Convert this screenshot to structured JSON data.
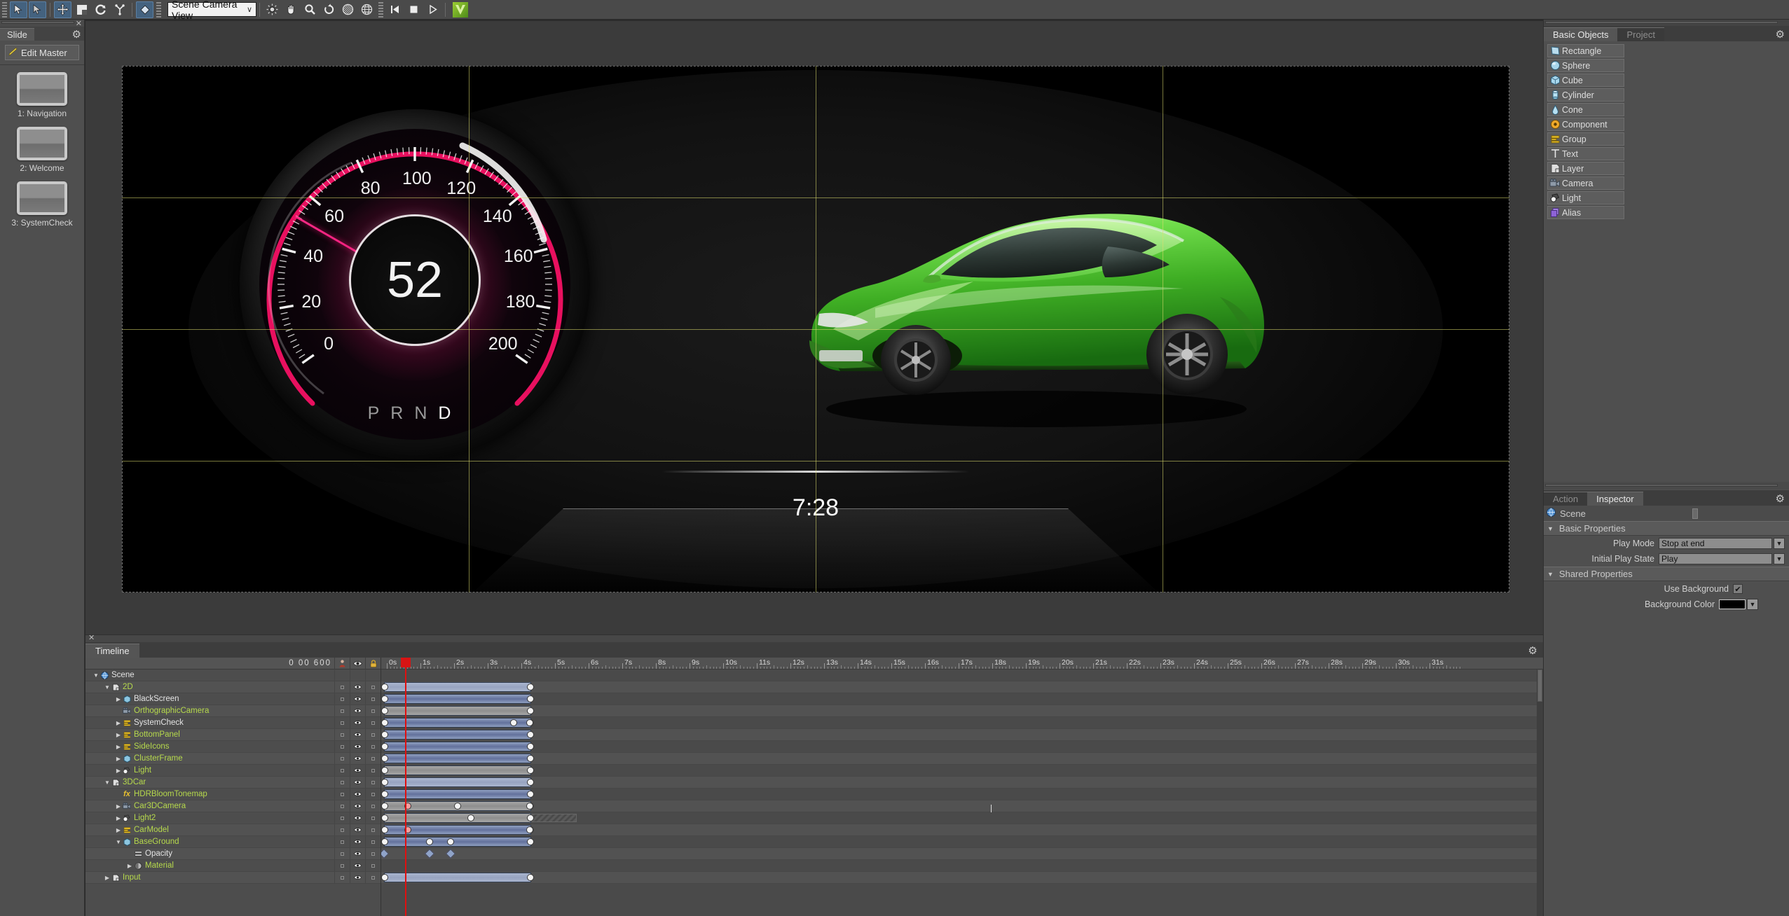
{
  "toolbar": {
    "tools": [
      {
        "name": "select-arrow-tool",
        "glyph": "➤",
        "selected": true
      },
      {
        "name": "group-select-tool",
        "glyph": "➤",
        "selected": true
      },
      {
        "name": "move-tool",
        "glyph": "✥",
        "selected": true
      },
      {
        "name": "scale-tool",
        "glyph": "◰",
        "selected": false
      },
      {
        "name": "rotate-tool",
        "glyph": "↻",
        "selected": false
      },
      {
        "name": "global-local-tool",
        "glyph": "⤴",
        "selected": false
      },
      {
        "name": "keyframe-tool",
        "glyph": "◆",
        "selected": true
      }
    ],
    "camera_select": {
      "value": "Scene Camera View",
      "arrow": "∨"
    },
    "view_tools": [
      {
        "name": "orbit-icon",
        "glyph": "✹"
      },
      {
        "name": "pan-hand-icon",
        "glyph": "✋"
      },
      {
        "name": "zoom-magnifier-icon",
        "glyph": "⚲"
      },
      {
        "name": "reset-view-icon",
        "glyph": "↻"
      },
      {
        "name": "shading-mode-icon",
        "glyph": "▒"
      },
      {
        "name": "wireframe-globe-icon",
        "glyph": "⊕"
      }
    ],
    "playback": [
      {
        "name": "rewind-to-start-button",
        "glyph": "⏮"
      },
      {
        "name": "stop-button",
        "glyph": "■"
      },
      {
        "name": "play-button",
        "glyph": "▶"
      }
    ],
    "app_logo": "V"
  },
  "slide_panel": {
    "tab_label": "Slide",
    "edit_master_label": "Edit Master",
    "gear_icon": "⚙",
    "close_icon": "✕",
    "slides": [
      {
        "label": "1: Navigation"
      },
      {
        "label": "2: Welcome"
      },
      {
        "label": "3: SystemCheck"
      }
    ]
  },
  "viewport": {
    "gauge": {
      "speed_value": "52",
      "ticks": [
        "0",
        "20",
        "40",
        "60",
        "80",
        "100",
        "120",
        "140",
        "160",
        "180",
        "200"
      ],
      "gear_letters": [
        "P",
        "R",
        "N",
        "D"
      ],
      "active_gear": "D",
      "needle_value": 52,
      "min": 0,
      "max": 200,
      "accent_color": "#f0147a"
    },
    "clock": "7:28",
    "car_color": "#5ed13a"
  },
  "right_panel": {
    "tabs": [
      {
        "label": "Basic Objects",
        "active": true
      },
      {
        "label": "Project",
        "active": false
      }
    ],
    "gear_icon": "⚙",
    "basic_objects": [
      {
        "label": "Rectangle",
        "icon": "rectangle-icon",
        "glyph": "◱",
        "color": "#9fd0e8"
      },
      {
        "label": "Sphere",
        "icon": "sphere-icon",
        "glyph": "●",
        "color": "#a8d8ee"
      },
      {
        "label": "Cube",
        "icon": "cube-icon",
        "glyph": "⬟",
        "color": "#a8d8ee"
      },
      {
        "label": "Cylinder",
        "icon": "cylinder-icon",
        "glyph": "▮",
        "color": "#b5e0f2"
      },
      {
        "label": "Cone",
        "icon": "cone-icon",
        "glyph": "▲",
        "color": "#b5e0f2"
      },
      {
        "label": "Component",
        "icon": "component-icon",
        "glyph": "◉",
        "color": "#f0a92a"
      },
      {
        "label": "Group",
        "icon": "group-icon",
        "glyph": "☰",
        "color": "#f2c020"
      },
      {
        "label": "Text",
        "icon": "text-icon",
        "glyph": "T",
        "color": "#e8e8e8"
      },
      {
        "label": "Layer",
        "icon": "layer-icon",
        "glyph": "◳",
        "color": "#dddddd"
      },
      {
        "label": "Camera",
        "icon": "camera-icon",
        "glyph": "὏7",
        "color": "#9aa6b5"
      },
      {
        "label": "Light",
        "icon": "light-icon",
        "glyph": "◑",
        "color": "#f0f0f0"
      },
      {
        "label": "Alias",
        "icon": "alias-icon",
        "glyph": "❐",
        "color": "#9b6ede"
      }
    ]
  },
  "inspector": {
    "tabs": [
      {
        "label": "Action",
        "active": false
      },
      {
        "label": "Inspector",
        "active": true
      }
    ],
    "gear_icon": "⚙",
    "object_name": "Scene",
    "object_icon": "globe-icon",
    "sections": [
      {
        "title": "Basic Properties",
        "rows": [
          {
            "label": "Play Mode",
            "type": "select",
            "value": "Stop at end"
          },
          {
            "label": "Initial Play State",
            "type": "select",
            "value": "Play"
          }
        ]
      },
      {
        "title": "Shared Properties",
        "rows": [
          {
            "label": "Use Background",
            "type": "checkbox",
            "value": "✔"
          },
          {
            "label": "Background Color",
            "type": "color",
            "value": "#000000"
          }
        ]
      }
    ]
  },
  "timeline": {
    "tab_label": "Timeline",
    "gear_icon": "⚙",
    "close_icon": "✕",
    "time_readout": "0  00  600",
    "column_icons": [
      {
        "name": "shy-column-icon",
        "glyph": "♟"
      },
      {
        "name": "visible-eye-column-icon",
        "glyph": "◉"
      },
      {
        "name": "lock-column-icon",
        "glyph": "ὑ2"
      }
    ],
    "ruler_labels": [
      "0s",
      "1s",
      "2s",
      "3s",
      "4s",
      "5s",
      "6s",
      "7s",
      "8s",
      "9s",
      "10s",
      "11s",
      "12s",
      "13s",
      "14s",
      "15s",
      "16s",
      "17s",
      "18s",
      "19s",
      "20s",
      "21s",
      "22s",
      "23s",
      "24s",
      "25s",
      "26s",
      "27s",
      "28s",
      "29s",
      "30s",
      "31s"
    ],
    "playhead_time": "0s",
    "rows": [
      {
        "name": "Scene",
        "indent": 0,
        "tri": "down",
        "icon": "globe-icon",
        "glyph": "◉",
        "color": "white",
        "bar": null,
        "header": true
      },
      {
        "name": "2D",
        "indent": 1,
        "tri": "down",
        "icon": "layer-icon",
        "glyph": "◳",
        "color": "green",
        "bar": {
          "type": "lblue",
          "start": 0,
          "end": 100
        },
        "keys": []
      },
      {
        "name": "BlackScreen",
        "indent": 2,
        "tri": "right",
        "icon": "cube-icon",
        "glyph": "⬟",
        "color": "white",
        "bar": {
          "type": "blue",
          "start": 0,
          "end": 100
        },
        "keys": []
      },
      {
        "name": "OrthographicCamera",
        "indent": 2,
        "tri": "none",
        "icon": "camera-icon",
        "glyph": "὏7",
        "color": "green",
        "bar": {
          "type": "grey",
          "start": 0,
          "end": 100
        },
        "keys": []
      },
      {
        "name": "SystemCheck",
        "indent": 2,
        "tri": "right",
        "icon": "group-icon",
        "glyph": "☰",
        "color": "white",
        "bar": {
          "type": "blue",
          "start": 0,
          "end": 100
        },
        "keys": [
          {
            "pos": 88,
            "red": false
          },
          {
            "pos": 99,
            "red": false
          }
        ]
      },
      {
        "name": "BottomPanel",
        "indent": 2,
        "tri": "right",
        "icon": "group-icon",
        "glyph": "☰",
        "color": "green",
        "bar": {
          "type": "blue",
          "start": 0,
          "end": 100
        },
        "keys": []
      },
      {
        "name": "SideIcons",
        "indent": 2,
        "tri": "right",
        "icon": "group-icon",
        "glyph": "☰",
        "color": "green",
        "bar": {
          "type": "blue",
          "start": 0,
          "end": 100
        },
        "keys": []
      },
      {
        "name": "ClusterFrame",
        "indent": 2,
        "tri": "right",
        "icon": "cube-icon",
        "glyph": "⬟",
        "color": "green",
        "bar": {
          "type": "blue",
          "start": 0,
          "end": 100
        },
        "keys": []
      },
      {
        "name": "Light",
        "indent": 2,
        "tri": "right",
        "icon": "light-icon",
        "glyph": "◑",
        "color": "green",
        "bar": {
          "type": "grey",
          "start": 0,
          "end": 100
        },
        "keys": []
      },
      {
        "name": "3DCar",
        "indent": 1,
        "tri": "down",
        "icon": "layer-icon",
        "glyph": "◳",
        "color": "green",
        "bar": {
          "type": "lblue",
          "start": 0,
          "end": 100
        },
        "keys": []
      },
      {
        "name": "HDRBloomTonemap",
        "indent": 2,
        "tri": "none",
        "icon": "effect-fx-icon",
        "glyph": "fx",
        "color": "green",
        "bar": {
          "type": "blue",
          "start": 0,
          "end": 100
        },
        "keys": []
      },
      {
        "name": "Car3DCamera",
        "indent": 2,
        "tri": "right",
        "icon": "camera-icon",
        "glyph": "὏7",
        "color": "green",
        "bar": {
          "type": "grey",
          "start": 0,
          "end": 100
        },
        "keys": [
          {
            "pos": 16,
            "red": true
          },
          {
            "pos": 50,
            "red": false
          },
          {
            "pos": 99,
            "red": false
          }
        ]
      },
      {
        "name": "Light2",
        "indent": 2,
        "tri": "right",
        "icon": "light-icon",
        "glyph": "◑",
        "color": "green",
        "bar": {
          "type": "grey",
          "start": 0,
          "end": 100
        },
        "keys": [
          {
            "pos": 59,
            "red": false
          }
        ],
        "hatch": {
          "start": 102,
          "end": 133
        }
      },
      {
        "name": "CarModel",
        "indent": 2,
        "tri": "right",
        "icon": "group-icon",
        "glyph": "☰",
        "color": "green",
        "bar": {
          "type": "blue",
          "start": 0,
          "end": 100
        },
        "keys": [
          {
            "pos": 16,
            "red": true
          },
          {
            "pos": 99,
            "red": false
          }
        ]
      },
      {
        "name": "BaseGround",
        "indent": 2,
        "tri": "down",
        "icon": "cube-icon",
        "glyph": "⬟",
        "color": "green",
        "bar": {
          "type": "blue",
          "start": 0,
          "end": 100
        },
        "keys": [
          {
            "pos": 31,
            "red": false
          },
          {
            "pos": 45,
            "red": false
          }
        ]
      },
      {
        "name": "Opacity",
        "indent": 3,
        "tri": "none",
        "icon": "property-icon",
        "glyph": "☰",
        "color": "white",
        "bar": null,
        "diamonds": [
          0,
          31,
          45
        ]
      },
      {
        "name": "Material",
        "indent": 3,
        "tri": "right",
        "icon": "material-icon",
        "glyph": "○",
        "color": "green",
        "bar": null,
        "keys": []
      },
      {
        "name": "Input",
        "indent": 1,
        "tri": "right",
        "icon": "layer-icon",
        "glyph": "◳",
        "color": "green",
        "bar": {
          "type": "lblue",
          "start": 0,
          "end": 100
        },
        "keys": []
      }
    ]
  }
}
